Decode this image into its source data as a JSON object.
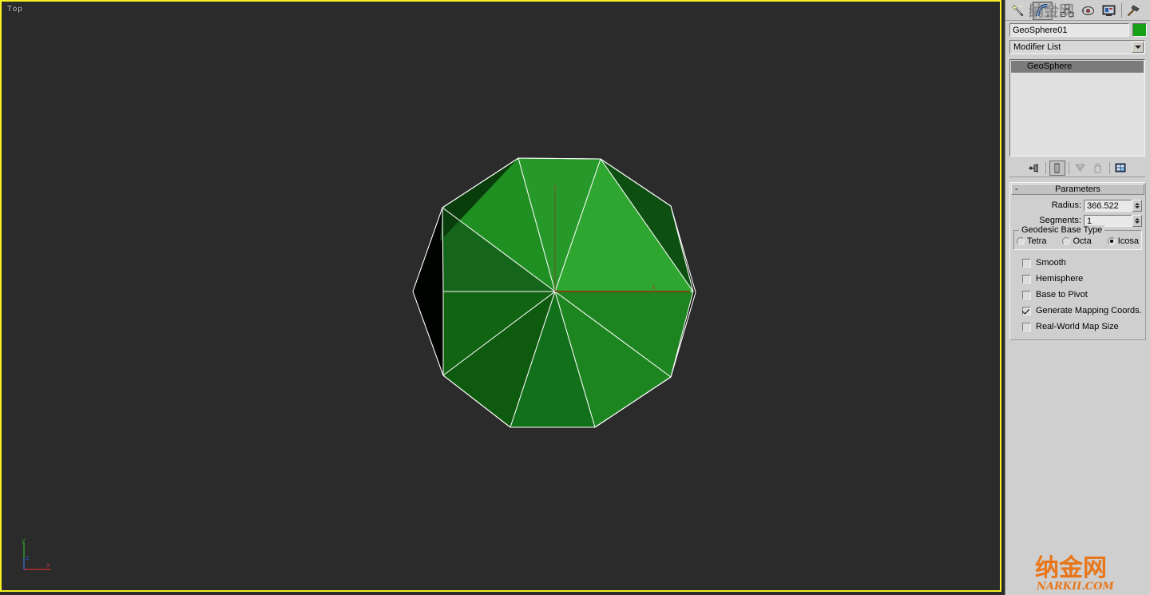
{
  "viewport": {
    "label": "Top",
    "background_color": "#2b2b2b",
    "active_border_color": "#f6f024",
    "axis_tripod": {
      "x_label": "x",
      "y_label": "y",
      "z_label": "z",
      "x_color": "#b03030",
      "y_color": "#2f8f2f",
      "z_color": "#3a50c0"
    },
    "object": {
      "name": "GeoSphere01",
      "wireframe_color": "#ffffff",
      "face_light": "#2fa02f",
      "face_mid": "#1e7a1e",
      "face_dark": "#135c13",
      "face_darker": "#0b3f0b",
      "face_black": "#040c04",
      "pivot_x_color": "#7a4a10",
      "pivot_y_color": "#4a5a20"
    }
  },
  "command_panel": {
    "tabs": [
      {
        "name": "create-tab",
        "icon": "wand-icon",
        "title": "Create",
        "active": false
      },
      {
        "name": "modify-tab",
        "icon": "arc-bend-icon",
        "title": "Modify",
        "active": true
      },
      {
        "name": "hierarchy-tab",
        "icon": "hierarchy-nodes-icon",
        "title": "Hierarchy",
        "active": false
      },
      {
        "name": "motion-tab",
        "icon": "motion-wheel-icon",
        "title": "Motion",
        "active": false
      },
      {
        "name": "display-tab",
        "icon": "display-monitor-icon",
        "title": "Display",
        "active": false
      },
      {
        "name": "utilities-tab",
        "icon": "hammer-icon",
        "title": "Utilities",
        "active": false
      }
    ],
    "object_name": "GeoSphere01",
    "object_color": "#16a016",
    "modifier_list_label": "Modifier List",
    "modifier_stack": [
      {
        "label": "GeoSphere",
        "selected": true
      }
    ],
    "stack_tools": [
      {
        "name": "pin-stack-icon",
        "title": "Pin Stack",
        "pressed": false
      },
      {
        "name": "show-end-result-icon",
        "title": "Show End Result",
        "pressed": true
      },
      {
        "name": "make-unique-icon",
        "title": "Make Unique",
        "pressed": false
      },
      {
        "name": "remove-modifier-icon",
        "title": "Remove Modifier",
        "pressed": false
      },
      {
        "name": "configure-modifier-sets-icon",
        "title": "Configure Modifier Sets",
        "pressed": false
      }
    ],
    "rollout": {
      "title": "Parameters",
      "collapse_glyph": "-",
      "params": [
        {
          "label": "Radius:",
          "value": "366.522",
          "name": "radius"
        },
        {
          "label": "Segments:",
          "value": "1",
          "name": "segments"
        }
      ],
      "geodesic_group": {
        "title": "Geodesic Base Type",
        "options": [
          {
            "label": "Tetra",
            "selected": false
          },
          {
            "label": "Octa",
            "selected": false
          },
          {
            "label": "Icosa",
            "selected": true
          }
        ]
      },
      "checkboxes": [
        {
          "label": "Smooth",
          "checked": false
        },
        {
          "label": "Hemisphere",
          "checked": false
        },
        {
          "label": "Base to Pivot",
          "checked": false
        },
        {
          "label": "Generate Mapping Coords.",
          "checked": true
        },
        {
          "label": "Real-World Map Size",
          "checked": false
        }
      ]
    }
  },
  "watermark": {
    "cn_text": "纳金网",
    "url_text": "NARKII.COM",
    "color": "#e8761a"
  }
}
